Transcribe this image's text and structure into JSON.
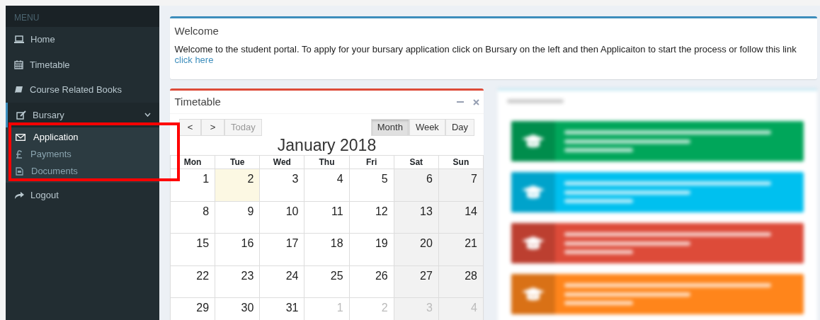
{
  "sidebar": {
    "header": "MENU",
    "items": [
      {
        "label": "Home",
        "kind": "link"
      },
      {
        "label": "Timetable",
        "kind": "link"
      },
      {
        "label": "Course Related Books",
        "kind": "link"
      },
      {
        "label": "Bursary",
        "kind": "group",
        "expanded": true,
        "children": [
          {
            "label": "Application",
            "selected": true
          },
          {
            "label": "Payments",
            "selected": false
          },
          {
            "label": "Documents",
            "selected": false
          }
        ]
      },
      {
        "label": "Logout",
        "kind": "link"
      }
    ]
  },
  "welcome": {
    "title": "Welcome",
    "text": "Welcome to the student portal. To apply for your bursary application click on Bursary on the left and then Applicaiton to start the process or follow this link",
    "link": "click here"
  },
  "timetable": {
    "title": "Timetable",
    "prev": "<",
    "next": ">",
    "today": {
      "label": "Today",
      "disabled": true
    },
    "views": [
      {
        "label": "Month",
        "selected": true
      },
      {
        "label": "Week",
        "selected": false
      },
      {
        "label": "Day",
        "selected": false
      }
    ],
    "month": "January 2018",
    "weekdays": [
      "Mon",
      "Tue",
      "Wed",
      "Thu",
      "Fri",
      "Sat",
      "Sun"
    ],
    "weeks": [
      [
        {
          "day": "1",
          "other": false,
          "today": false
        },
        {
          "day": "2",
          "other": false,
          "today": true
        },
        {
          "day": "3",
          "other": false,
          "today": false
        },
        {
          "day": "4",
          "other": false,
          "today": false
        },
        {
          "day": "5",
          "other": false,
          "today": false
        },
        {
          "day": "6",
          "other": false,
          "today": false
        },
        {
          "day": "7",
          "other": false,
          "today": false
        }
      ],
      [
        {
          "day": "8",
          "other": false,
          "today": false
        },
        {
          "day": "9",
          "other": false,
          "today": false
        },
        {
          "day": "10",
          "other": false,
          "today": false
        },
        {
          "day": "11",
          "other": false,
          "today": false
        },
        {
          "day": "12",
          "other": false,
          "today": false
        },
        {
          "day": "13",
          "other": false,
          "today": false
        },
        {
          "day": "14",
          "other": false,
          "today": false
        }
      ],
      [
        {
          "day": "15",
          "other": false,
          "today": false
        },
        {
          "day": "16",
          "other": false,
          "today": false
        },
        {
          "day": "17",
          "other": false,
          "today": false
        },
        {
          "day": "18",
          "other": false,
          "today": false
        },
        {
          "day": "19",
          "other": false,
          "today": false
        },
        {
          "day": "20",
          "other": false,
          "today": false
        },
        {
          "day": "21",
          "other": false,
          "today": false
        }
      ],
      [
        {
          "day": "22",
          "other": false,
          "today": false
        },
        {
          "day": "23",
          "other": false,
          "today": false
        },
        {
          "day": "24",
          "other": false,
          "today": false
        },
        {
          "day": "25",
          "other": false,
          "today": false
        },
        {
          "day": "26",
          "other": false,
          "today": false
        },
        {
          "day": "27",
          "other": false,
          "today": false
        },
        {
          "day": "28",
          "other": false,
          "today": false
        }
      ],
      [
        {
          "day": "29",
          "other": false,
          "today": false
        },
        {
          "day": "30",
          "other": false,
          "today": false
        },
        {
          "day": "31",
          "other": false,
          "today": false
        },
        {
          "day": "1",
          "other": true,
          "today": false
        },
        {
          "day": "2",
          "other": true,
          "today": false
        },
        {
          "day": "3",
          "other": true,
          "today": false
        },
        {
          "day": "4",
          "other": true,
          "today": false
        }
      ]
    ]
  },
  "courses": {
    "items": [
      {
        "color": "#00a65a"
      },
      {
        "color": "#00c0ef"
      },
      {
        "color": "#dd4b39"
      },
      {
        "color": "#ff851b"
      }
    ]
  }
}
